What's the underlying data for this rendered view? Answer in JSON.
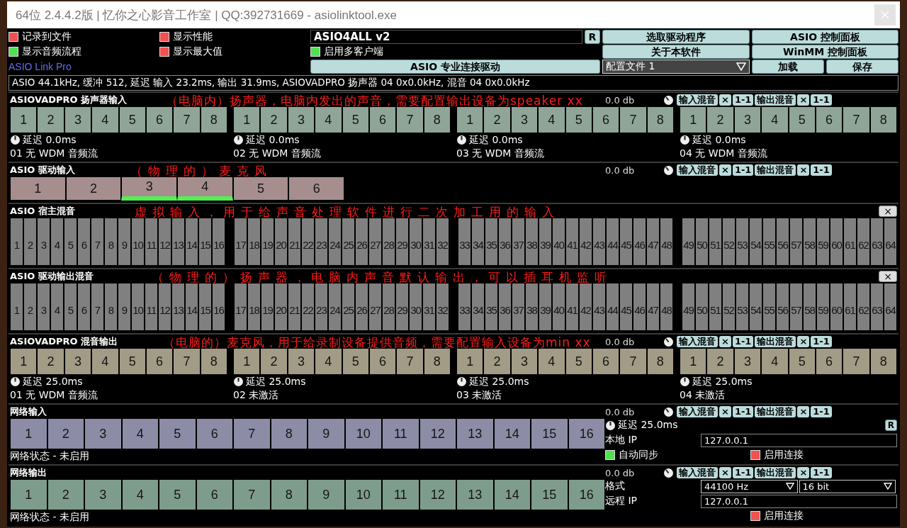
{
  "window": {
    "title": "64位 2.4.4.2版 | 忆你之心影音工作室 | QQ:392731669 - asiolinktool.exe"
  },
  "options": [
    {
      "label": "记录到文件",
      "checked": false
    },
    {
      "label": "显示性能",
      "checked": false
    },
    {
      "label": "显示音频流程",
      "checked": true
    },
    {
      "label": "显示最大值",
      "checked": false
    }
  ],
  "driver": {
    "value": "ASIO4ALL v2",
    "reset": "R"
  },
  "multi_client": {
    "label": "启用多客户端",
    "checked": true
  },
  "brand": "ASIO Link Pro",
  "buttons": [
    "选取驱动程序",
    "ASIO 控制面板",
    "关于本软件",
    "WinMM 控制面板",
    "ASIO 专业连接驱动",
    "加载",
    "保存"
  ],
  "profile": {
    "value": "配置文件 1"
  },
  "status": "ASIO 44.1kHz, 缓冲 512, 延迟 输入 23.2ms, 输出 31.9ms, ASIOVADPRO 扬声器 04 0x0.0kHz, 混音 04 0x0.0kHz",
  "sections": [
    {
      "kind": "wdm_in",
      "title": "ASIOVADPRO 扬声器输入",
      "annotation": "（电脑内）扬声器，电脑内发出的声音，需要配置输出设备为speaker xx",
      "level_text": "0.0 db",
      "mix_buttons": [
        "输入混音",
        "×",
        "1-1",
        "输出混音",
        "×",
        "1-1"
      ],
      "groups": [
        {
          "channels": [
            "1",
            "2",
            "3",
            "4",
            "5",
            "6",
            "7",
            "8"
          ],
          "latency": "延迟 0.0ms",
          "name": "01 无 WDM 音频流"
        },
        {
          "channels": [
            "1",
            "2",
            "3",
            "4",
            "5",
            "6",
            "7",
            "8"
          ],
          "latency": "延迟 0.0ms",
          "name": "02 无 WDM 音频流"
        },
        {
          "channels": [
            "1",
            "2",
            "3",
            "4",
            "5",
            "6",
            "7",
            "8"
          ],
          "latency": "延迟 0.0ms",
          "name": "03 无 WDM 音频流"
        },
        {
          "channels": [
            "1",
            "2",
            "3",
            "4",
            "5",
            "6",
            "7",
            "8"
          ],
          "latency": "延迟 0.0ms",
          "name": "04 无 WDM 音频流"
        }
      ]
    },
    {
      "kind": "driver_in",
      "title": "ASIO 驱动输入",
      "annotation": "（物理的）麦克风",
      "level_text": "0.0 db",
      "mix_buttons": [
        "输入混音",
        "×",
        "1-1",
        "输出混音",
        "×",
        "1-1"
      ],
      "groups": [
        {
          "channels": [
            {
              "label": "1",
              "active": false
            },
            {
              "label": "2",
              "active": false
            },
            {
              "label": "3",
              "active": true
            },
            {
              "label": "4",
              "active": true
            },
            {
              "label": "5",
              "active": false
            },
            {
              "label": "6",
              "active": false
            }
          ]
        }
      ]
    },
    {
      "kind": "host_mix",
      "title": "ASIO 宿主混音",
      "annotation": "虚拟输入，用于给声音处理软件进行二次加工用的输入",
      "close": "×",
      "groups": [
        {
          "channels": [
            "1",
            "2",
            "3",
            "4",
            "5",
            "6",
            "7",
            "8",
            "9",
            "10",
            "11",
            "12",
            "13",
            "14",
            "15",
            "16"
          ]
        },
        {
          "channels": [
            "17",
            "18",
            "19",
            "20",
            "21",
            "22",
            "23",
            "24",
            "25",
            "26",
            "27",
            "28",
            "29",
            "30",
            "31",
            "32"
          ]
        },
        {
          "channels": [
            "33",
            "34",
            "35",
            "36",
            "37",
            "38",
            "39",
            "40",
            "41",
            "42",
            "43",
            "44",
            "45",
            "46",
            "47",
            "48"
          ]
        },
        {
          "channels": [
            "49",
            "50",
            "51",
            "52",
            "53",
            "54",
            "55",
            "56",
            "57",
            "58",
            "59",
            "60",
            "61",
            "62",
            "63",
            "64"
          ]
        }
      ]
    },
    {
      "kind": "driver_out",
      "title": "ASIO 驱动输出混音",
      "annotation": "（物理的）扬声器，电脑内声音默认输出，可以插耳机监听",
      "close": "×",
      "groups": [
        {
          "channels": [
            "1",
            "2",
            "3",
            "4",
            "5",
            "6",
            "7",
            "8",
            "9",
            "10",
            "11",
            "12",
            "13",
            "14",
            "15",
            "16"
          ]
        },
        {
          "channels": [
            "17",
            "18",
            "19",
            "20",
            "21",
            "22",
            "23",
            "24",
            "25",
            "26",
            "27",
            "28",
            "29",
            "30",
            "31",
            "32"
          ]
        },
        {
          "channels": [
            "33",
            "34",
            "35",
            "36",
            "37",
            "38",
            "39",
            "40",
            "41",
            "42",
            "43",
            "44",
            "45",
            "46",
            "47",
            "48"
          ]
        },
        {
          "channels": [
            "49",
            "50",
            "51",
            "52",
            "53",
            "54",
            "55",
            "56",
            "57",
            "58",
            "59",
            "60",
            "61",
            "62",
            "63",
            "64"
          ]
        }
      ]
    },
    {
      "kind": "wdm_out",
      "title": "ASIOVADPRO 混音输出",
      "annotation": "（电脑的）麦克风，用于给录制设备提供音频，需要配置输入设备为min xx",
      "level_text": "0.0 db",
      "mix_buttons": [
        "输入混音",
        "×",
        "1-1",
        "输出混音",
        "×",
        "1-1"
      ],
      "groups": [
        {
          "channels": [
            "1",
            "2",
            "3",
            "4",
            "5",
            "6",
            "7",
            "8"
          ],
          "latency": "延迟 25.0ms",
          "name": "01 无 WDM 音频流"
        },
        {
          "channels": [
            "1",
            "2",
            "3",
            "4",
            "5",
            "6",
            "7",
            "8"
          ],
          "latency": "延迟 25.0ms",
          "name": "02 未激活"
        },
        {
          "channels": [
            "1",
            "2",
            "3",
            "4",
            "5",
            "6",
            "7",
            "8"
          ],
          "latency": "延迟 25.0ms",
          "name": "03 未激活"
        },
        {
          "channels": [
            "1",
            "2",
            "3",
            "4",
            "5",
            "6",
            "7",
            "8"
          ],
          "latency": "延迟 25.0ms",
          "name": "04 未激活"
        }
      ]
    },
    {
      "kind": "net_in",
      "title": "网络输入",
      "level_text": "0.0 db",
      "mix_buttons": [
        "输入混音",
        "×",
        "1-1",
        "输出混音",
        "×",
        "1-1"
      ],
      "groups": [
        {
          "channels": [
            "1",
            "2",
            "3",
            "4",
            "5",
            "6",
            "7",
            "8",
            "9",
            "10",
            "11",
            "12",
            "13",
            "14",
            "15",
            "16"
          ]
        }
      ],
      "network_status": "网络状态 - 未启用",
      "panel": {
        "latency": "延迟 25.0ms",
        "reset": "R",
        "ip_label": "本地 IP",
        "ip": "127.0.0.1",
        "sync": {
          "label": "自动同步",
          "checked": true
        },
        "connect": {
          "label": "启用连接",
          "checked": false
        }
      }
    },
    {
      "kind": "net_out",
      "title": "网络输出",
      "level_text": "0.0 db",
      "mix_buttons": [
        "输入混音",
        "×",
        "1-1",
        "输出混音",
        "×",
        "1-1"
      ],
      "groups": [
        {
          "channels": [
            "1",
            "2",
            "3",
            "4",
            "5",
            "6",
            "7",
            "8",
            "9",
            "10",
            "11",
            "12",
            "13",
            "14",
            "15",
            "16"
          ]
        }
      ],
      "network_status": "网络状态 - 未启用",
      "panel": {
        "format_label": "格式",
        "rate": "44100 Hz",
        "bits": "16 bit",
        "ip_label": "远程 IP",
        "ip": "127.0.0.1",
        "connect": {
          "label": "启用连接",
          "checked": false
        }
      }
    }
  ]
}
